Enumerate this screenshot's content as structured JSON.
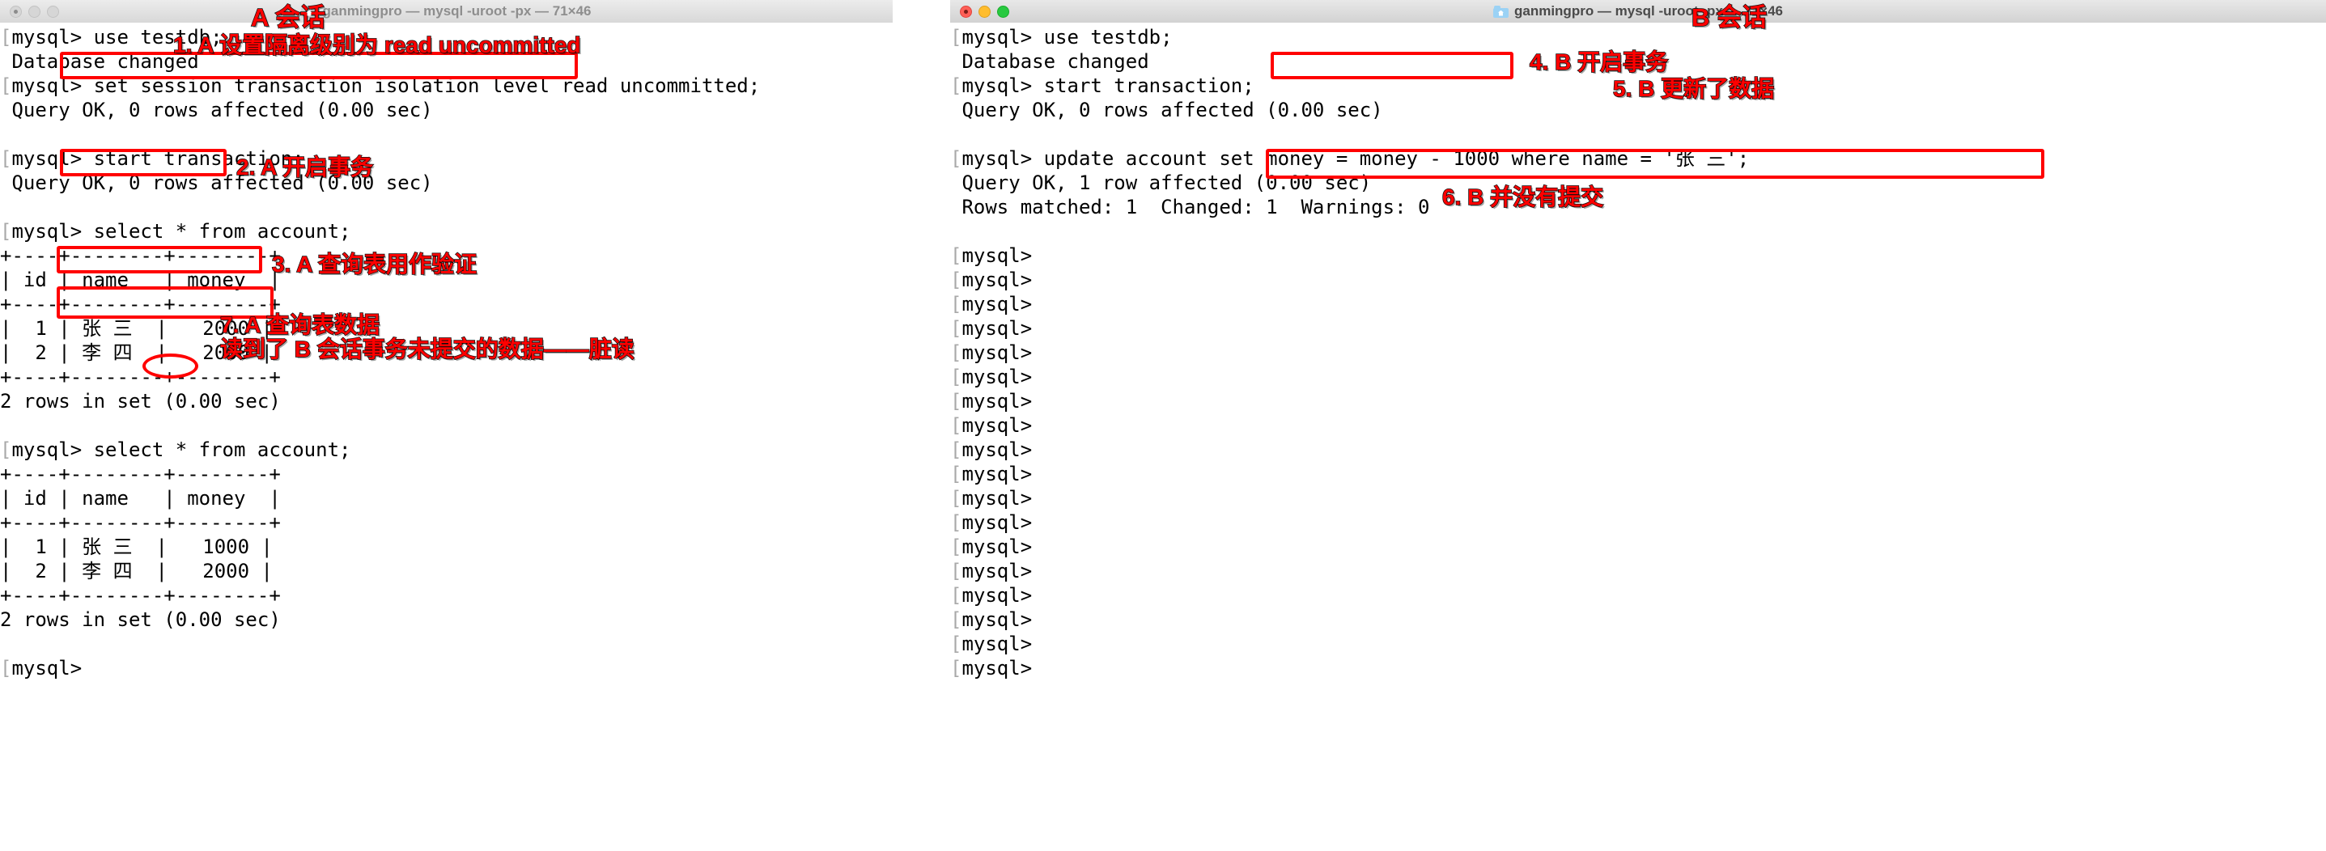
{
  "window_a": {
    "name": "terminal-window-a",
    "title": "ganmingpro — mysql -uroot -px — 71×46",
    "folder_icon": "folder-icon",
    "active": false,
    "traffic_lights": [
      "close-button",
      "minimize-button",
      "maximize-button"
    ],
    "lines": [
      "[mysql> use testdb;",
      " Database changed",
      "[mysql> set session transaction isolation level read uncommitted;",
      " Query OK, 0 rows affected (0.00 sec)",
      "",
      "[mysql> start transaction;",
      " Query OK, 0 rows affected (0.00 sec)",
      "",
      "[mysql> select * from account;",
      "+----+--------+--------+",
      "| id | name   | money  |",
      "+----+--------+--------+",
      "|  1 | 张 三  |   2000 |",
      "|  2 | 李 四  |   2000 |",
      "+----+--------+--------+",
      "2 rows in set (0.00 sec)",
      "",
      "[mysql> select * from account;",
      "+----+--------+--------+",
      "| id | name   | money  |",
      "+----+--------+--------+",
      "|  1 | 张 三  |   1000 |",
      "|  2 | 李 四  |   2000 |",
      "+----+--------+--------+",
      "2 rows in set (0.00 sec)",
      "",
      "[mysql>"
    ]
  },
  "window_b": {
    "name": "terminal-window-b",
    "title": "ganmingpro — mysql -uroot -px — 71×46",
    "folder_icon": "folder-icon",
    "active": true,
    "traffic_lights": [
      "close-button",
      "minimize-button",
      "maximize-button"
    ],
    "lines": [
      "[mysql> use testdb;",
      " Database changed",
      "[mysql> start transaction;",
      " Query OK, 0 rows affected (0.00 sec)",
      "",
      "[mysql> update account set money = money - 1000 where name = '张 三';",
      " Query OK, 1 row affected (0.00 sec)",
      " Rows matched: 1  Changed: 1  Warnings: 0",
      "",
      "[mysql>",
      "[mysql>",
      "[mysql>",
      "[mysql>",
      "[mysql>",
      "[mysql>",
      "[mysql>",
      "[mysql>",
      "[mysql>",
      "[mysql>",
      "[mysql>",
      "[mysql>",
      "[mysql>",
      "[mysql>",
      "[mysql>",
      "[mysql>",
      "[mysql>",
      "[mysql>"
    ]
  },
  "annotations": {
    "title_a": "A 会话",
    "title_b": "B 会话",
    "step1": "1. A 设置隔离级别为 read uncommitted",
    "step2": "2. A 开启事务",
    "step3": "3. A 查询表用作验证",
    "step4": "4. B 开启事务",
    "step5": "5. B 更新了数据",
    "step6": "6. B 并没有提交",
    "step7": "7. A 查询表数据",
    "step7b": "读到了 B 会话事务未提交的数据——脏读"
  },
  "colors": {
    "annotation_red": "#ff0000",
    "annotation_outline": "#111111",
    "terminal_fg": "#000000",
    "terminal_bg": "#ffffff",
    "close": "#ff5f57",
    "minimize": "#ffbd2e",
    "maximize": "#28c940"
  }
}
